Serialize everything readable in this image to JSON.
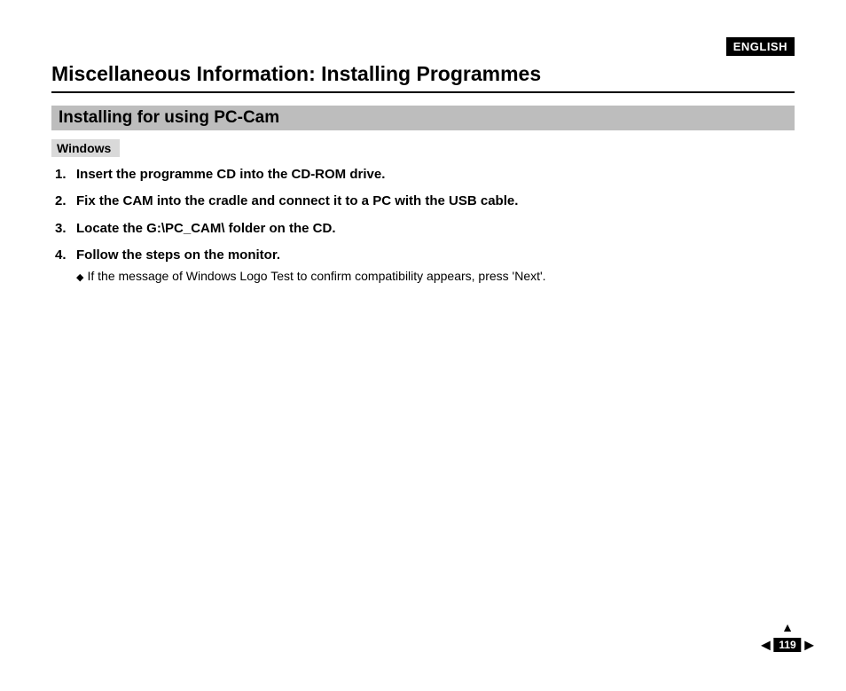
{
  "language_tag": "ENGLISH",
  "title": "Miscellaneous Information: Installing Programmes",
  "section_heading": "Installing for using PC-Cam",
  "os_tag": "Windows",
  "steps": [
    {
      "n": "1.",
      "text": "Insert the programme CD into the CD-ROM drive."
    },
    {
      "n": "2.",
      "text": "Fix the CAM into the cradle and connect it to a PC with the USB cable."
    },
    {
      "n": "3.",
      "text": "Locate the G:\\PC_CAM\\ folder on the CD."
    },
    {
      "n": "4.",
      "text": "Follow the steps on the monitor.",
      "sub": "If the message of Windows Logo Test to confirm compatibility appears, press 'Next'."
    }
  ],
  "page_number": "119"
}
